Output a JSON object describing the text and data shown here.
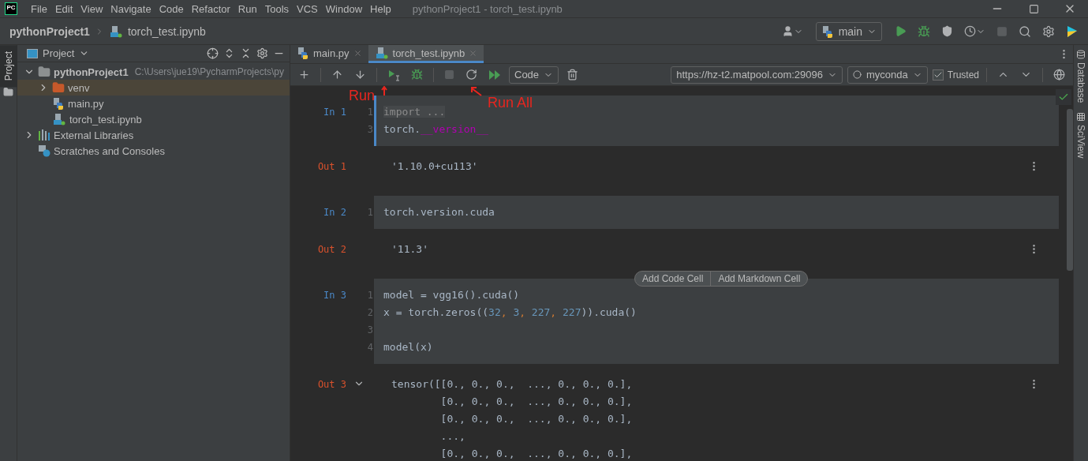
{
  "app_logo": "PC",
  "menu": [
    "File",
    "Edit",
    "View",
    "Navigate",
    "Code",
    "Refactor",
    "Run",
    "Tools",
    "VCS",
    "Window",
    "Help"
  ],
  "window_title": "pythonProject1 - torch_test.ipynb",
  "breadcrumb": [
    "pythonProject1",
    "torch_test.ipynb"
  ],
  "run_config": "main",
  "left_stripe_tab": "Project",
  "project_panel": {
    "title": "Project",
    "tree": [
      {
        "label": "pythonProject1",
        "path": "C:\\Users\\jue19\\PycharmProjects\\py",
        "kind": "project",
        "expanded": true,
        "selected": false,
        "children": [
          {
            "label": "venv",
            "kind": "folder",
            "expanded": false,
            "selected": true
          },
          {
            "label": "main.py",
            "kind": "python",
            "selected": false
          },
          {
            "label": "torch_test.ipynb",
            "kind": "notebook",
            "selected": false
          }
        ]
      },
      {
        "label": "External Libraries",
        "kind": "libraries",
        "expanded": false,
        "selected": false
      },
      {
        "label": "Scratches and Consoles",
        "kind": "scratches",
        "selected": false
      }
    ]
  },
  "editor_tabs": [
    {
      "label": "main.py",
      "kind": "python",
      "selected": false
    },
    {
      "label": "torch_test.ipynb",
      "kind": "notebook",
      "selected": true
    }
  ],
  "notebook_toolbar": {
    "cell_type": "Code",
    "server": "https://hz-t2.matpool.com:29096",
    "kernel": "myconda",
    "trusted": {
      "label": "Trusted",
      "checked": true
    }
  },
  "annotations": [
    {
      "kind": "run",
      "label": "Run"
    },
    {
      "kind": "run_all",
      "label": "Run All"
    }
  ],
  "cells": [
    {
      "prompt": "In 1",
      "active": true,
      "lines": [
        {
          "number": "1",
          "tokens": [
            {
              "kind": "folded",
              "text": "import ..."
            }
          ]
        },
        {
          "number": "3",
          "tokens": [
            {
              "kind": "plain",
              "text": "torch."
            },
            {
              "kind": "dunder",
              "text": "__version__"
            }
          ]
        }
      ],
      "output": {
        "prompt": "Out 1",
        "lines": [
          "'1.10.0+cu113'"
        ]
      }
    },
    {
      "prompt": "In 2",
      "active": false,
      "lines": [
        {
          "number": "1",
          "tokens": [
            {
              "kind": "plain",
              "text": "torch.version.cuda"
            }
          ]
        }
      ],
      "output": {
        "prompt": "Out 2",
        "lines": [
          "'11.3'"
        ]
      }
    },
    {
      "prompt": "In 3",
      "active": false,
      "add_buttons": [
        "Add Code Cell",
        "Add Markdown Cell"
      ],
      "lines": [
        {
          "number": "1",
          "tokens": [
            {
              "kind": "plain",
              "text": "model = vgg16().cuda()"
            }
          ]
        },
        {
          "number": "2",
          "tokens": [
            {
              "kind": "plain",
              "text": "x = torch.zeros(("
            },
            {
              "kind": "number",
              "text": "32"
            },
            {
              "kind": "punct",
              "text": ", "
            },
            {
              "kind": "number",
              "text": "3"
            },
            {
              "kind": "punct",
              "text": ", "
            },
            {
              "kind": "number",
              "text": "227"
            },
            {
              "kind": "punct",
              "text": ", "
            },
            {
              "kind": "number",
              "text": "227"
            },
            {
              "kind": "plain",
              "text": ")).cuda()"
            }
          ]
        },
        {
          "number": "3"
        },
        {
          "number": "4",
          "tokens": [
            {
              "kind": "plain",
              "text": "model(x)"
            }
          ]
        }
      ],
      "output": {
        "prompt": "Out 3",
        "expanded": true,
        "lines": [
          "tensor([[0., 0., 0.,  ..., 0., 0., 0.],",
          "        [0., 0., 0.,  ..., 0., 0., 0.],",
          "        [0., 0., 0.,  ..., 0., 0., 0.],",
          "        ...,",
          "        [0., 0., 0.,  ..., 0., 0., 0.],"
        ]
      }
    }
  ],
  "right_stripe": [
    "Database",
    "SciView"
  ]
}
